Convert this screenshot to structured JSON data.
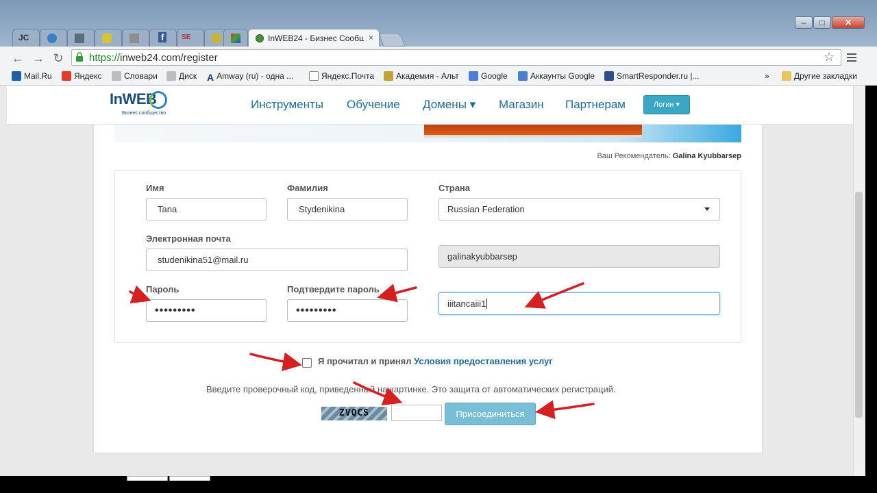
{
  "browser": {
    "tab_title": "InWEB24 - Бизнес Сообщ",
    "tab_close": "×",
    "url_scheme": "https://",
    "url_rest": "inweb24.com/register",
    "background_tab_labels": [
      "JC",
      "",
      "",
      "",
      "f",
      "SE",
      "",
      ""
    ],
    "bookmarks": [
      "Mail.Ru",
      "Яндекс",
      "Словари",
      "Диск",
      "Amway (ru) - одна ...",
      "Яндекс.Почта",
      "Академия - Альт",
      "Google",
      "Аккаунты Google",
      "SmartResponder.ru |..."
    ],
    "bookmarks_overflow": "»",
    "other_bookmarks": "Другие закладки"
  },
  "site": {
    "logo": "InWEB",
    "logo_sub": "Бизнес сообщество",
    "nav": [
      "Инструменты",
      "Обучение",
      "Домены ▾",
      "Магазин",
      "Партнерам"
    ],
    "login_button": "Логин ▾"
  },
  "referrer": {
    "label": "Ваш Рекомендатель:",
    "name": "Galina Kyubbarsep"
  },
  "form": {
    "first_name_label": "Имя",
    "first_name_value": "Tana",
    "last_name_label": "Фамилия",
    "last_name_value": "Stydenikina",
    "country_label": "Страна",
    "country_value": "Russian Federation",
    "email_label": "Электронная почта",
    "email_value": "studenikina51@mail.ru",
    "sponsor_value": "galinakyubbarsep",
    "password_label": "Пароль",
    "password_value": "•••••••••",
    "confirm_label": "Подтвердите пароль",
    "confirm_value": "•••••••••",
    "username_value": "iiitancaiii1"
  },
  "terms": {
    "text": "Я прочитал и принял ",
    "link": "Условия предоставления услуг"
  },
  "captcha": {
    "note": "Введите проверочный код, приведенный на картинке. Это защита от автоматических регистраций.",
    "code": "ZVQCS",
    "join_button": "Присоединиться"
  },
  "colors": {
    "link": "#1e6d9d",
    "button": "#77bfd6",
    "annotation_arrow": "#d42020"
  }
}
